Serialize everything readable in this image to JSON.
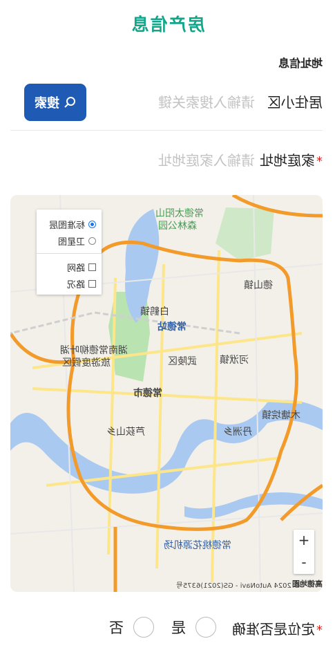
{
  "page_title": "房产信息",
  "section_title": "地址信息",
  "community": {
    "label": "居住小区",
    "placeholder": "请输入搜索关键",
    "search_button": "搜索"
  },
  "home_address": {
    "label": "家庭地址",
    "required_mark": "*",
    "placeholder": "请输入家庭地址"
  },
  "map": {
    "layers": {
      "standard": "标准图层",
      "satellite": "卫星图",
      "roads": "路网",
      "traffic": "路况"
    },
    "labels": {
      "forest_park": "常德太阳山",
      "forest_park2": "森林公园",
      "deshan": "德山镇",
      "station": "常德站",
      "scenic": "湖南常德柳叶湖",
      "scenic2": "旅游度假区",
      "wuling": "武陵区",
      "hefu": "河洑镇",
      "city": "常德市",
      "lujia": "芦荻山乡",
      "danzhou": "丹洲乡",
      "muta": "木塘垸镇",
      "airport": "常德桃花源机场",
      "baima": "白鹤镇"
    },
    "zoom_in": "+",
    "zoom_out": "-",
    "copyright": "© 2024 AutoNavi - GS(2021)6375号",
    "logo": "高德地图"
  },
  "location_accuracy": {
    "label": "定位是否准确",
    "required_mark": "*",
    "yes": "是",
    "no": "否"
  },
  "colors": {
    "title": "#12a58a",
    "button": "#1f5bb5",
    "ring_road": "#f29b2b",
    "water": "#aac9f0",
    "green": "#b9e3b1"
  }
}
